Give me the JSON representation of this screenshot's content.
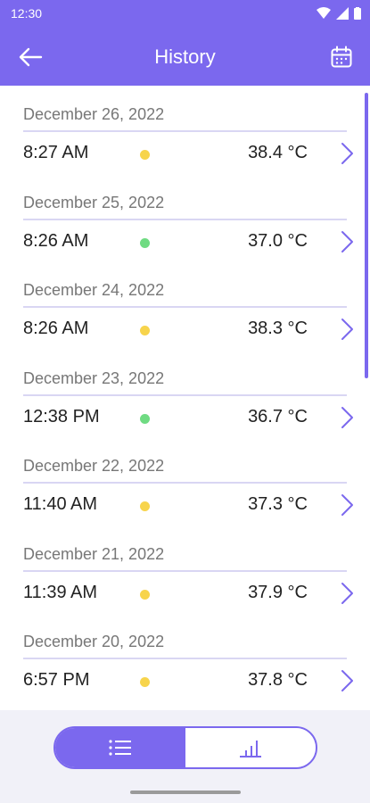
{
  "status_bar": {
    "time": "12:30"
  },
  "app_bar": {
    "title": "History"
  },
  "colors": {
    "accent": "#7b68ee",
    "status_yellow": "#f7d44c",
    "status_green": "#6fdb82"
  },
  "history": [
    {
      "date": "December 26, 2022",
      "time": "8:27 AM",
      "temperature": "38.4 °C",
      "status": "yellow"
    },
    {
      "date": "December 25, 2022",
      "time": "8:26 AM",
      "temperature": "37.0 °C",
      "status": "green"
    },
    {
      "date": "December 24, 2022",
      "time": "8:26 AM",
      "temperature": "38.3 °C",
      "status": "yellow"
    },
    {
      "date": "December 23, 2022",
      "time": "12:38 PM",
      "temperature": "36.7 °C",
      "status": "green"
    },
    {
      "date": "December 22, 2022",
      "time": "11:40 AM",
      "temperature": "37.3 °C",
      "status": "yellow"
    },
    {
      "date": "December 21, 2022",
      "time": "11:39 AM",
      "temperature": "37.9 °C",
      "status": "yellow"
    },
    {
      "date": "December 20, 2022",
      "time": "6:57 PM",
      "temperature": "37.8 °C",
      "status": "yellow"
    }
  ],
  "bottom_toggle": {
    "active": "list-view",
    "icons": [
      "list-icon",
      "bar-chart-icon"
    ]
  }
}
